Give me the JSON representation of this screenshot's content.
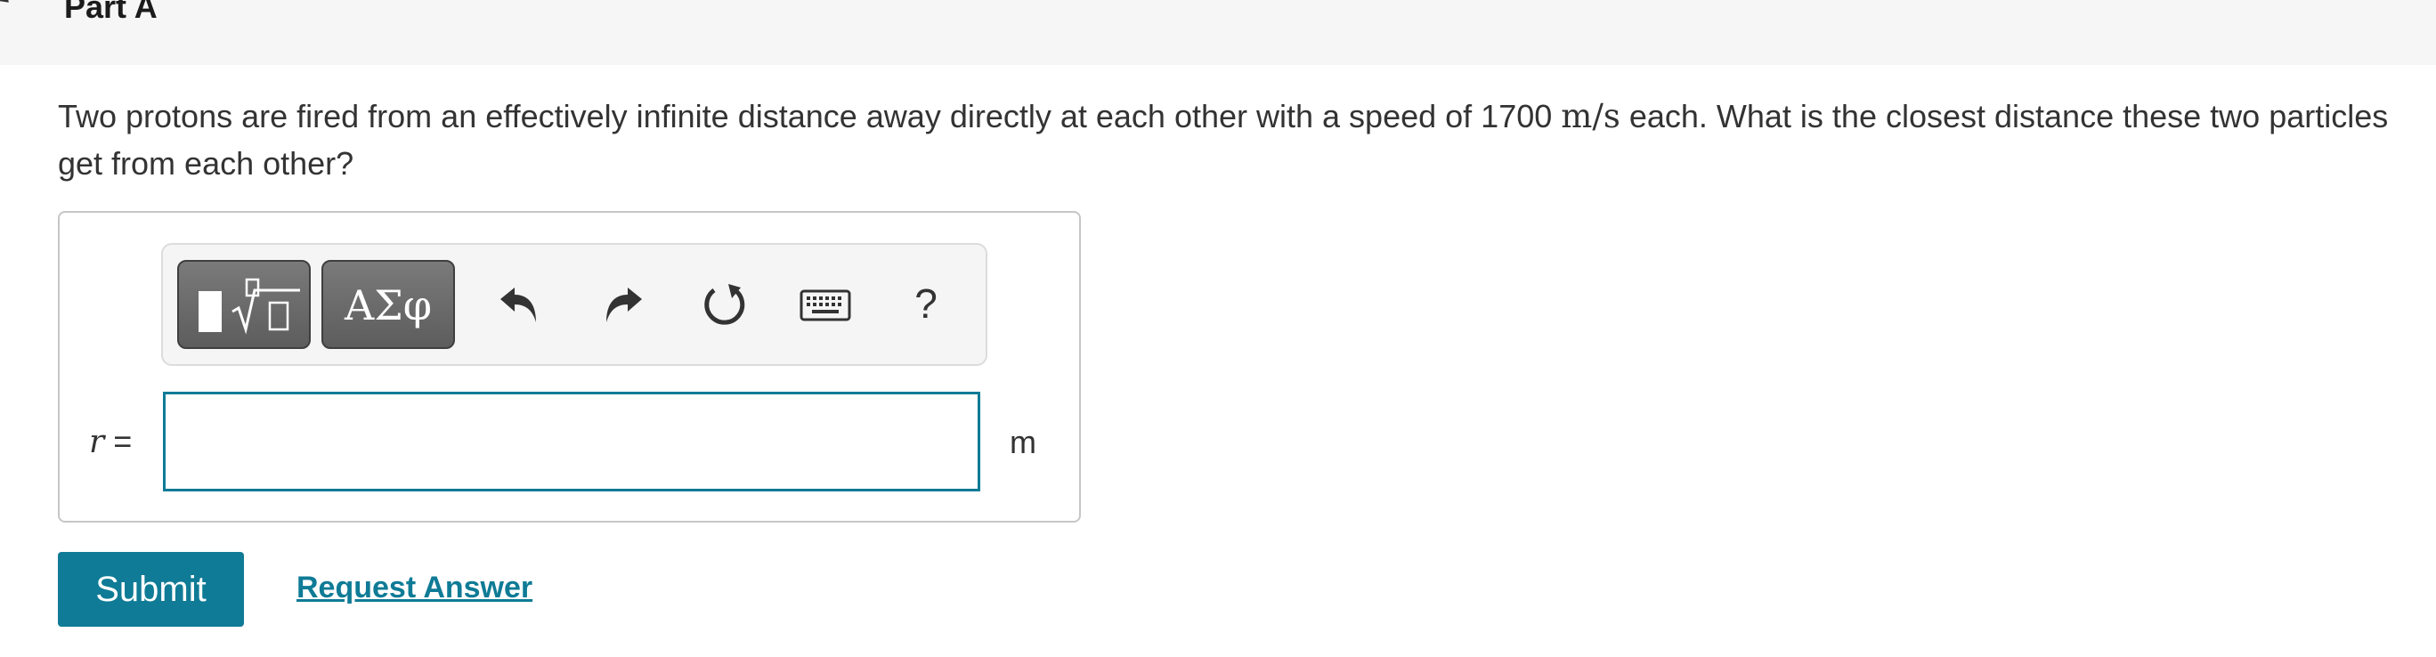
{
  "part": {
    "title": "Part A"
  },
  "question": {
    "text_before_unit": "Two protons are fired from an effectively infinite distance away directly at each other with a speed of 1700 ",
    "unit_m": "m",
    "unit_slash": "/",
    "unit_s": "s",
    "text_after_unit": " each. What is the closest distance these two particles get from each other?"
  },
  "toolbar": {
    "templates_icon": "templates-icon",
    "symbols_label": "ΑΣφ",
    "undo_icon": "undo-icon",
    "redo_icon": "redo-icon",
    "reset_icon": "reset-icon",
    "keyboard_icon": "keyboard-icon",
    "help_label": "?"
  },
  "answer": {
    "variable": "r",
    "equals": " =",
    "input_value": "",
    "unit": "m"
  },
  "actions": {
    "submit_label": "Submit",
    "request_answer_label": "Request Answer"
  },
  "colors": {
    "accent": "#0f7b96",
    "header_bg": "#f6f6f6",
    "toolbar_bg": "#f5f5f5",
    "dark_button": "#666666"
  }
}
